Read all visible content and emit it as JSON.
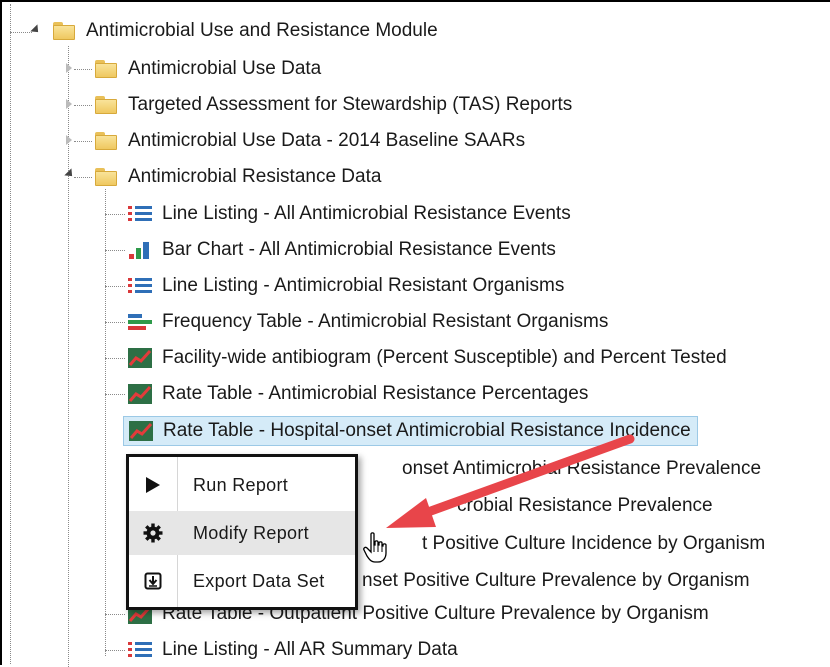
{
  "tree": {
    "root": {
      "label": "Antimicrobial Use and Resistance Module",
      "icon": "folder-icon"
    },
    "folders": [
      {
        "label": "Antimicrobial Use Data",
        "icon": "folder-icon"
      },
      {
        "label": "Targeted Assessment for Stewardship (TAS) Reports",
        "icon": "folder-icon"
      },
      {
        "label": "Antimicrobial Use Data - 2014 Baseline SAARs",
        "icon": "folder-icon"
      },
      {
        "label": "Antimicrobial Resistance Data",
        "icon": "folder-icon"
      }
    ],
    "reports": [
      {
        "label": "Line Listing - All Antimicrobial Resistance Events",
        "icon": "line-listing-icon"
      },
      {
        "label": "Bar Chart - All Antimicrobial Resistance Events",
        "icon": "bar-chart-icon"
      },
      {
        "label": "Line Listing - Antimicrobial Resistant Organisms",
        "icon": "line-listing-icon"
      },
      {
        "label": "Frequency Table - Antimicrobial Resistant Organisms",
        "icon": "frequency-table-icon"
      },
      {
        "label": "Facility-wide antibiogram (Percent Susceptible) and Percent Tested",
        "icon": "rate-table-icon"
      },
      {
        "label": "Rate Table - Antimicrobial Resistance Percentages",
        "icon": "rate-table-icon"
      },
      {
        "label": "Rate Table - Hospital-onset Antimicrobial Resistance Incidence",
        "icon": "rate-table-icon"
      },
      {
        "label": "onset Antimicrobial Resistance Prevalence",
        "icon": "rate-table-icon"
      },
      {
        "label": "crobial Resistance Prevalence",
        "icon": "rate-table-icon"
      },
      {
        "label": "t Positive Culture Incidence by Organism",
        "icon": "rate-table-icon"
      },
      {
        "label": "nset Positive Culture Prevalence by Organism",
        "icon": "rate-table-icon"
      },
      {
        "label": "Rate Table - Outpatient Positive Culture Prevalence by Organism",
        "icon": "rate-table-icon"
      },
      {
        "label": "Line Listing - All AR Summary Data",
        "icon": "line-listing-icon"
      }
    ]
  },
  "context_menu": {
    "items": [
      {
        "label": "Run Report",
        "icon": "play-icon"
      },
      {
        "label": "Modify Report",
        "icon": "gear-icon"
      },
      {
        "label": "Export Data Set",
        "icon": "export-icon"
      }
    ]
  },
  "colors": {
    "selection": "#d5ebf8",
    "arrow": "#e8454a",
    "folder": "#f2cd68"
  }
}
